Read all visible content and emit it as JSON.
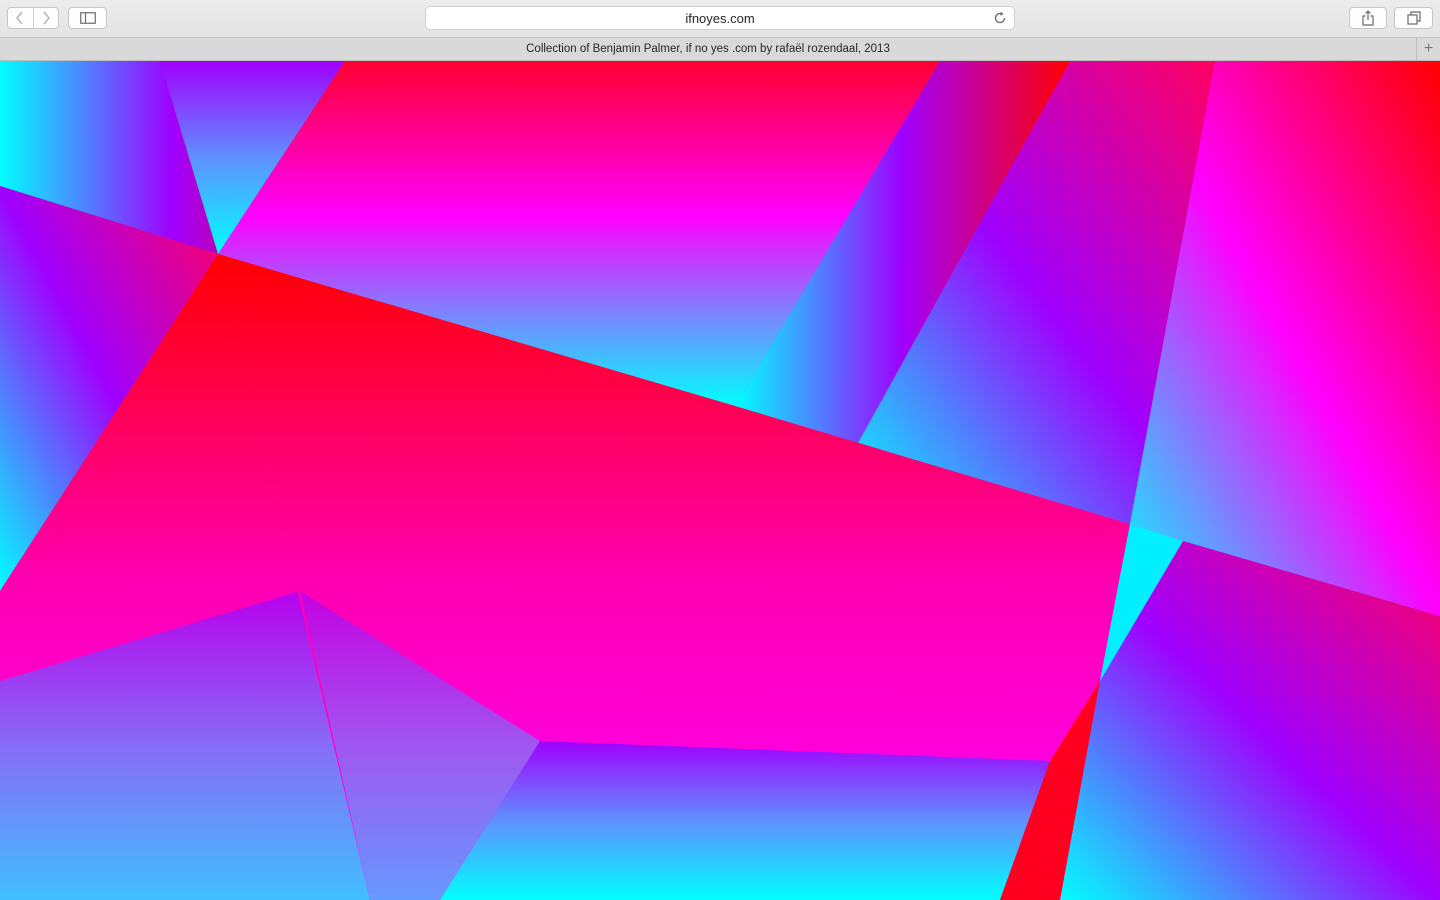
{
  "browser": {
    "address": "ifnoyes.com",
    "tab_title": "Collection of Benjamin Palmer, if no yes .com by rafaël rozendaal, 2013",
    "new_tab_symbol": "+",
    "icons": {
      "back": "chevron-left-icon",
      "forward": "chevron-right-icon",
      "sidebar": "sidebar-icon",
      "reload": "reload-icon",
      "share": "share-icon",
      "tabs": "tabs-overview-icon"
    }
  },
  "artwork": {
    "palette": {
      "red": "#ff0000",
      "pink": "#ff0080",
      "magenta": "#ff00ff",
      "violet": "#a000ff",
      "blue": "#6090ff",
      "cyan": "#00ffff"
    }
  }
}
